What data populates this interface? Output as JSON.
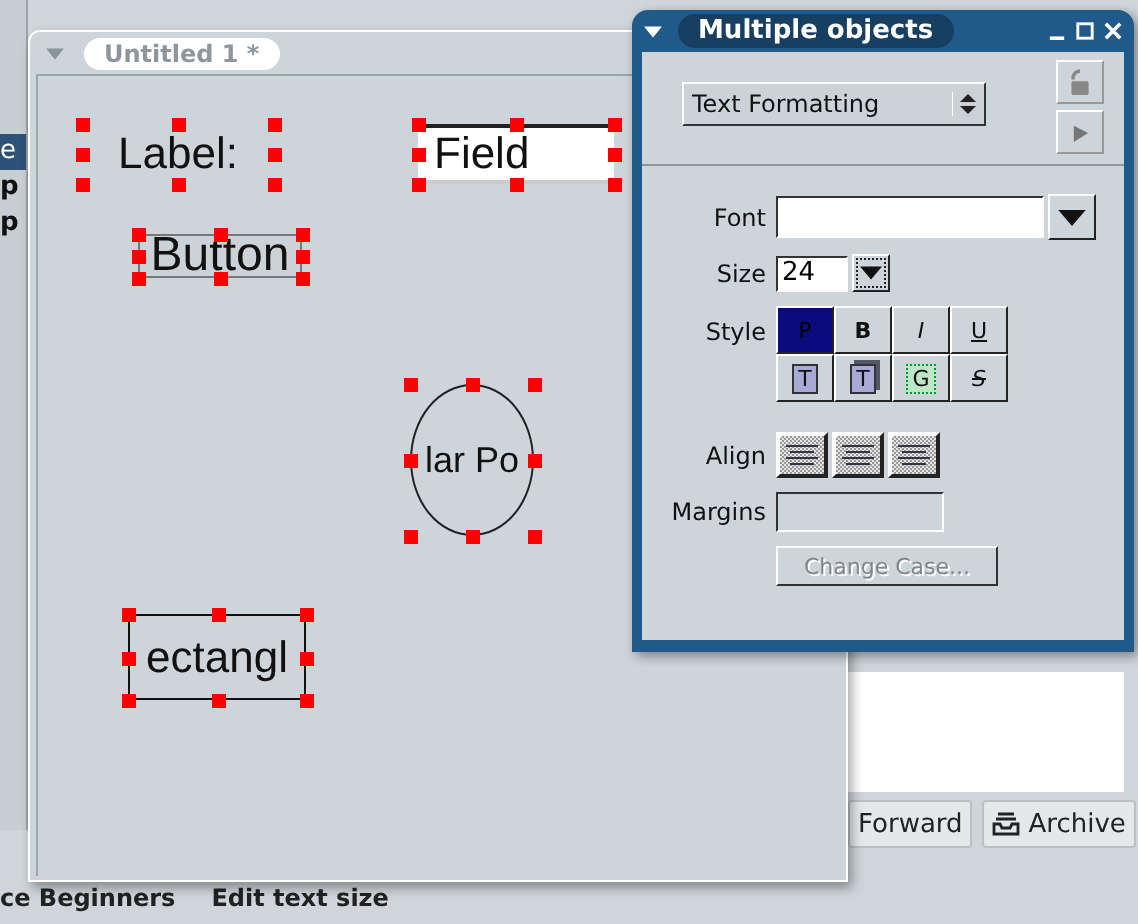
{
  "background_window": {
    "rows": [
      {
        "text": "e",
        "selected": true
      },
      {
        "text": "p",
        "selected": false
      },
      {
        "text": "p",
        "selected": false
      }
    ]
  },
  "document_window": {
    "title": "Untitled 1 *",
    "objects": [
      {
        "kind": "label",
        "text": "Label:"
      },
      {
        "kind": "field",
        "text": "Field"
      },
      {
        "kind": "button",
        "text": "Button"
      },
      {
        "kind": "ellipse",
        "text": "lar Po"
      },
      {
        "kind": "rectangle",
        "text": "ectangl"
      }
    ]
  },
  "inspector": {
    "title": "Multiple objects",
    "section": "Text Formatting",
    "font": {
      "label": "Font"
    },
    "size": {
      "label": "Size",
      "value": "24"
    },
    "style": {
      "label": "Style",
      "buttons": [
        {
          "glyph": "P",
          "kind": "plain",
          "selected": true
        },
        {
          "glyph": "B",
          "kind": "bold",
          "selected": false
        },
        {
          "glyph": "I",
          "kind": "italic",
          "selected": false
        },
        {
          "glyph": "U",
          "kind": "underline",
          "selected": false
        },
        {
          "glyph": "T",
          "kind": "box",
          "selected": false
        },
        {
          "glyph": "T",
          "kind": "shadow",
          "selected": false
        },
        {
          "glyph": "G",
          "kind": "dotted",
          "selected": false
        },
        {
          "glyph": "S",
          "kind": "strike",
          "selected": false
        }
      ]
    },
    "align": {
      "label": "Align",
      "buttons": [
        {
          "selected": false
        },
        {
          "selected": false
        },
        {
          "selected": false
        }
      ]
    },
    "margins": {
      "label": "Margins"
    },
    "change_case": {
      "label": "Change Case...",
      "disabled": true
    }
  },
  "background_app": {
    "buttons": [
      {
        "label": "Forward",
        "kind": "plain"
      },
      {
        "label": "Archive",
        "kind": "archive"
      }
    ],
    "status": [
      "ce Beginners",
      "Edit text size"
    ]
  }
}
